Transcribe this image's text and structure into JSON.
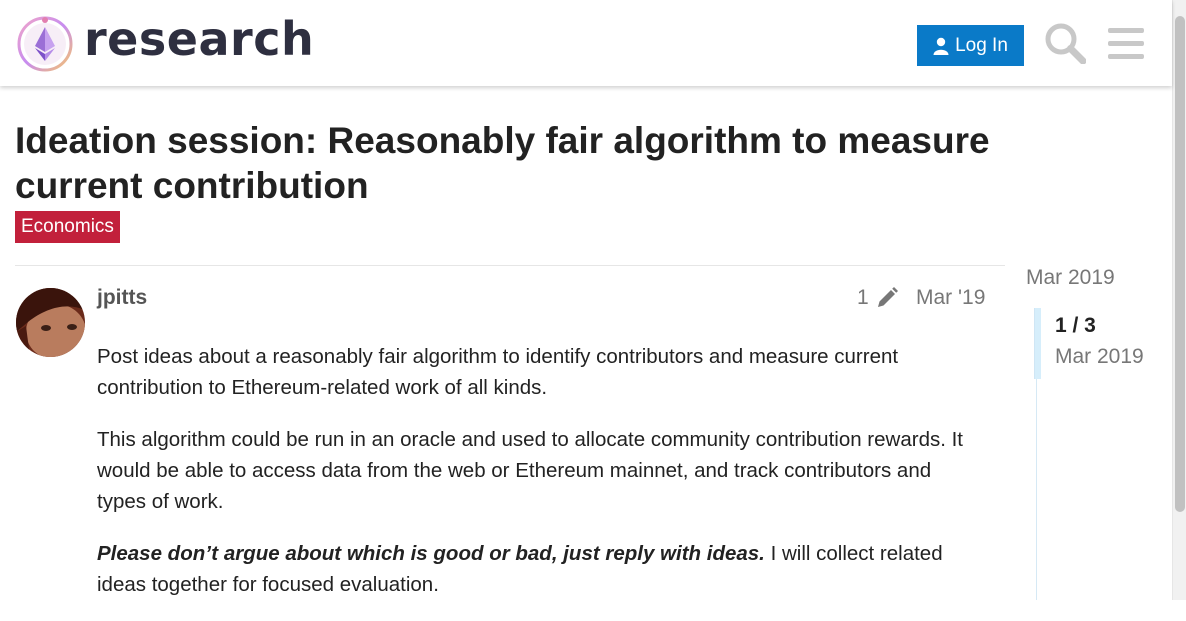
{
  "header": {
    "site_name": "research",
    "login_label": "Log In"
  },
  "topic": {
    "title": "Ideation session: Reasonably fair algorithm to measure current contribution",
    "category": "Economics",
    "category_color": "#c2203b"
  },
  "post": {
    "username": "jpitts",
    "edit_count": "1",
    "date": "Mar '19",
    "paragraphs": [
      "Post ideas about a reasonably fair algorithm to identify contributors and measure current contribution to Ethereum-related work of all kinds.",
      "This algorithm could be run in an oracle and used to allocate community contribution rewards. It would be able to access data from the web or Ethereum mainnet, and track contributors and types of work."
    ],
    "emphasis_text": "Please don’t argue about which is good or bad, just reply with ideas.",
    "after_emphasis_text": " I will collect related ideas together for focused evaluation."
  },
  "timeline": {
    "start_date": "Mar 2019",
    "position": "1 / 3",
    "current_date": "Mar 2019"
  },
  "colors": {
    "accent": "#0a7ac8",
    "category": "#c2203b",
    "muted_text": "#777777"
  }
}
